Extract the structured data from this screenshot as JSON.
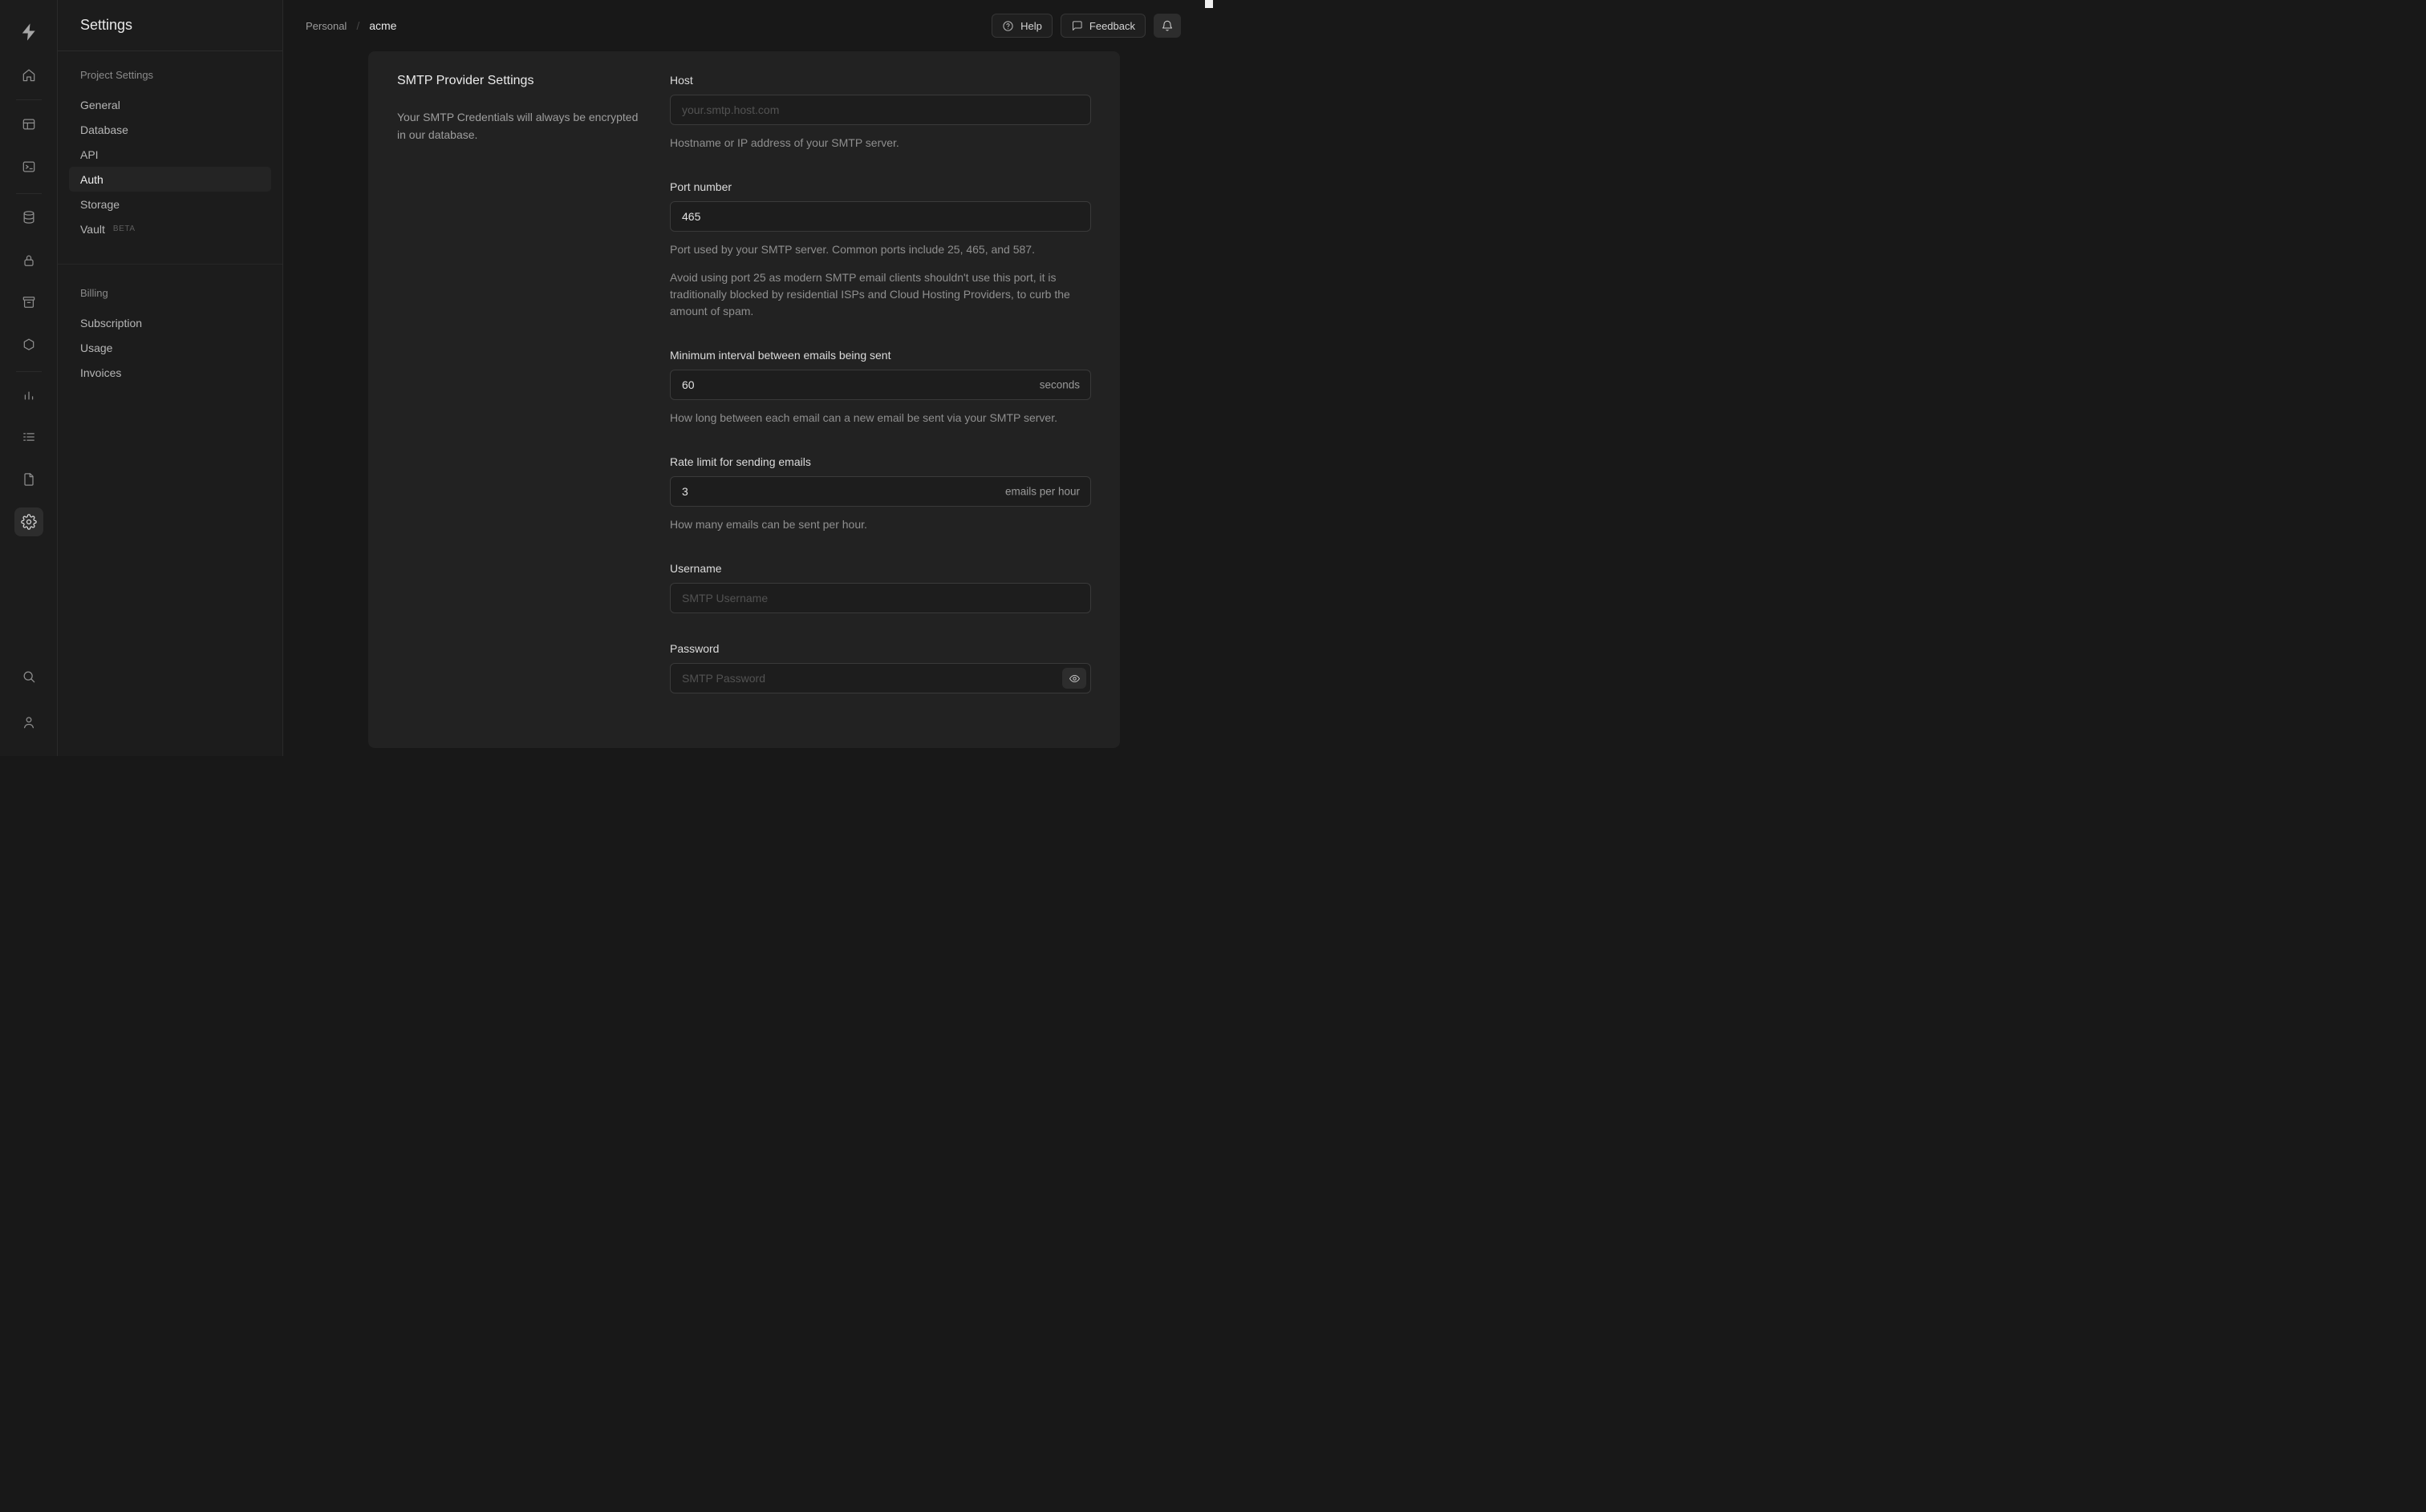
{
  "colors": {
    "background": "#181818",
    "sidebar": "#1c1c1c",
    "card": "#222222",
    "input_background": "#1d1d1d",
    "border": "#3a3a3a",
    "text_primary": "#e8e8e8",
    "text_muted": "#8f8f8f"
  },
  "icons": {
    "logo": "supabase-bolt",
    "rail": [
      "home",
      "table-editor-grid",
      "sql-editor-terminal",
      "database-cylinder",
      "auth-lock",
      "storage-archive",
      "edge-functions-hexagon",
      "reports-bar-chart",
      "logs-list",
      "docs-file",
      "settings-gear",
      "search-magnifier",
      "user-person"
    ],
    "header": [
      "help-circle",
      "feedback-speech-bubble",
      "notifications-bell"
    ],
    "password_field": "eye"
  },
  "nav": {
    "title": "Settings",
    "sections": [
      {
        "heading": "Project Settings",
        "items": [
          {
            "label": "General"
          },
          {
            "label": "Database"
          },
          {
            "label": "API"
          },
          {
            "label": "Auth",
            "active": true
          },
          {
            "label": "Storage"
          },
          {
            "label": "Vault",
            "badge": "BETA"
          }
        ]
      },
      {
        "heading": "Billing",
        "items": [
          {
            "label": "Subscription"
          },
          {
            "label": "Usage"
          },
          {
            "label": "Invoices"
          }
        ]
      }
    ]
  },
  "header": {
    "breadcrumb": {
      "org": "Personal",
      "separator": "/",
      "project": "acme"
    },
    "buttons": {
      "help": "Help",
      "feedback": "Feedback"
    }
  },
  "panel": {
    "title": "SMTP Provider Settings",
    "description": "Your SMTP Credentials will always be encrypted in our database.",
    "fields": {
      "host": {
        "label": "Host",
        "placeholder": "your.smtp.host.com",
        "helper": "Hostname or IP address of your SMTP server."
      },
      "port": {
        "label": "Port number",
        "value": "465",
        "helper_1": "Port used by your SMTP server. Common ports include 25, 465, and 587.",
        "helper_2": "Avoid using port 25 as modern SMTP email clients shouldn't use this port, it is traditionally blocked by residential ISPs and Cloud Hosting Providers, to curb the amount of spam."
      },
      "interval": {
        "label": "Minimum interval between emails being sent",
        "value": "60",
        "suffix": "seconds",
        "helper": "How long between each email can a new email be sent via your SMTP server."
      },
      "rate": {
        "label": "Rate limit for sending emails",
        "value": "3",
        "suffix": "emails per hour",
        "helper": "How many emails can be sent per hour."
      },
      "username": {
        "label": "Username",
        "placeholder": "SMTP Username"
      },
      "password": {
        "label": "Password",
        "placeholder": "SMTP Password"
      }
    }
  }
}
